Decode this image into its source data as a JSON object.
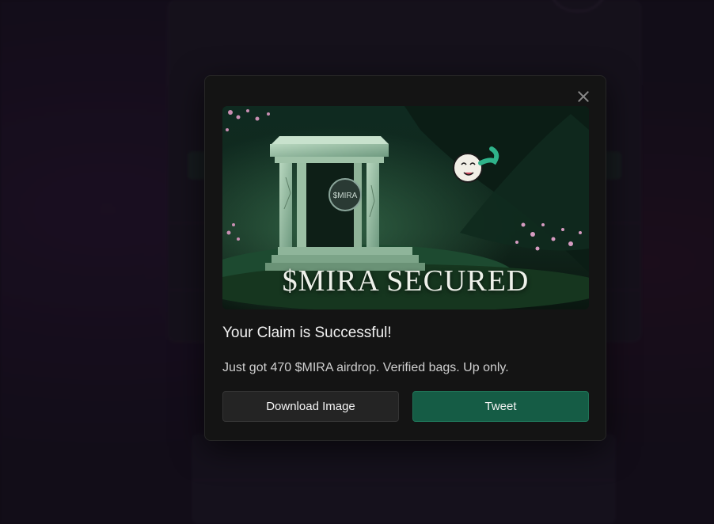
{
  "modal": {
    "hero_title": "$MIRA SECURED",
    "hero_badge_text": "$MIRA",
    "heading": "Your Claim is Successful!",
    "message": "Just got 470 $MIRA airdrop. Verified bags. Up only.",
    "download_label": "Download Image",
    "tweet_label": "Tweet",
    "close_icon": "close-icon"
  },
  "colors": {
    "modal_bg": "#141414",
    "tweet_button": "#155c45",
    "download_button": "#242424",
    "page_bg": "#17111f"
  }
}
